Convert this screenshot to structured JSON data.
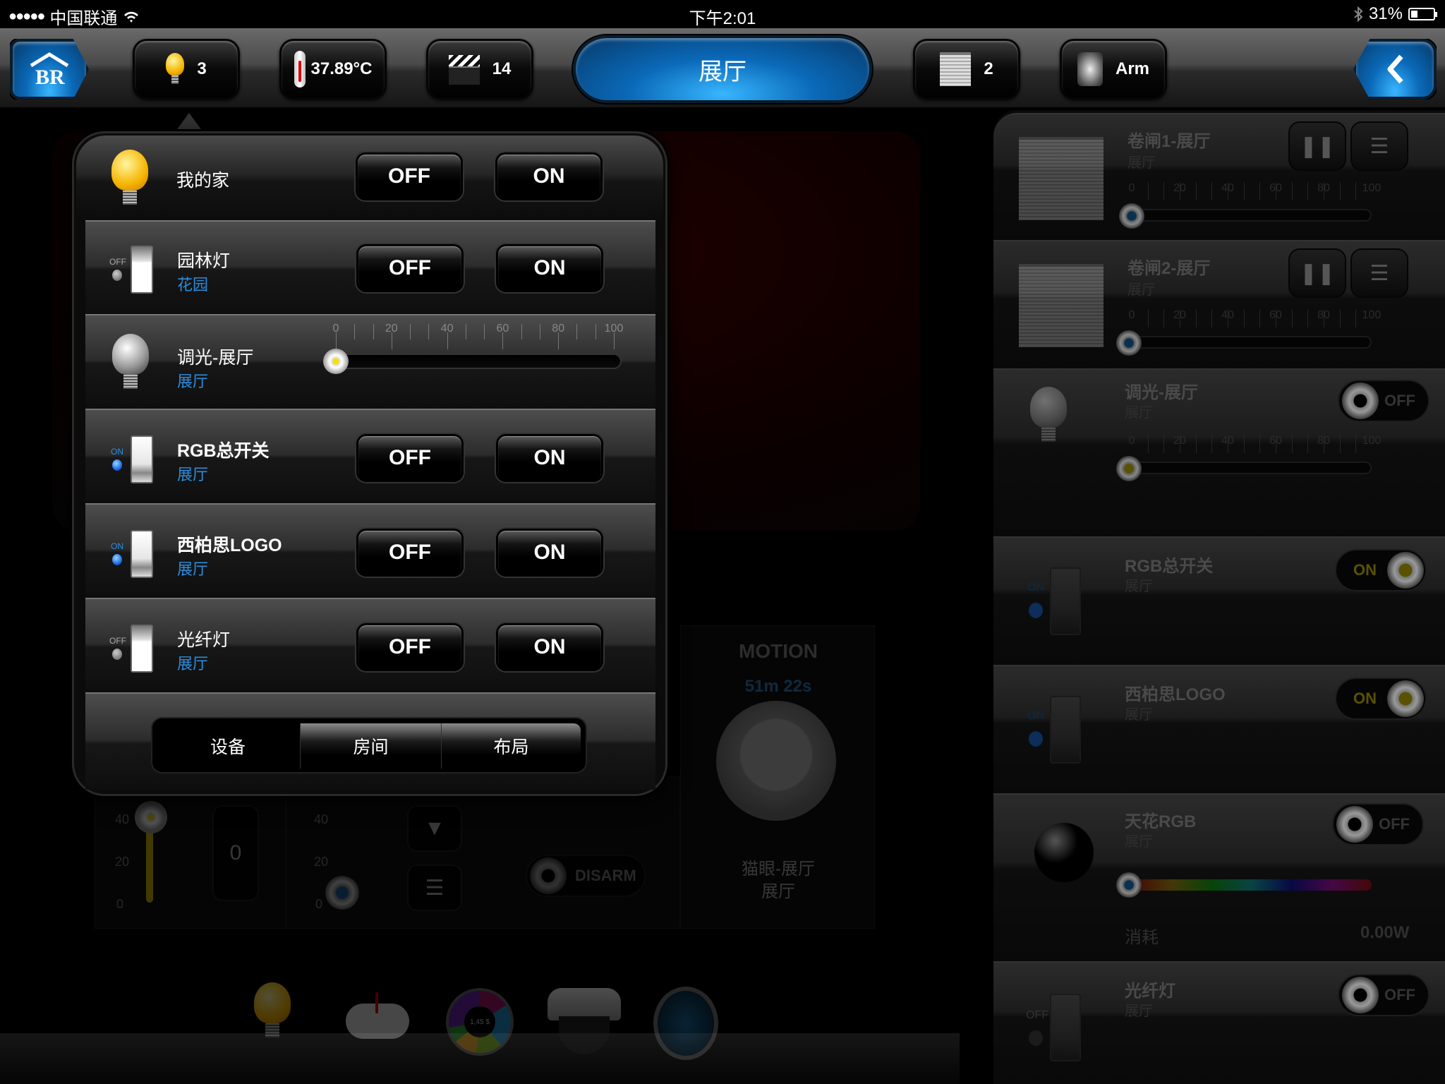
{
  "status_bar": {
    "signal": "●●●●●",
    "carrier": "中国联通",
    "wifi_icon": "wifi-icon",
    "time": "下午2:01",
    "bluetooth_icon": "bluetooth-icon",
    "battery": "31%",
    "battery_level": 0.31
  },
  "topbar": {
    "home_logo_icon": "br-house-logo-icon",
    "lights": {
      "icon": "light-bulb-icon",
      "count": "3"
    },
    "temperature": {
      "icon": "thermometer-icon",
      "value": "37.89°C"
    },
    "scenes": {
      "icon": "clapperboard-icon",
      "count": "14"
    },
    "room_title": "展厅",
    "shutters": {
      "icon": "shutter-icon",
      "count": "2"
    },
    "security": {
      "icon": "security-icon",
      "label": "Arm"
    },
    "back_icon": "chevron-left-icon"
  },
  "popup": {
    "header": {
      "name": "我的家",
      "off_label": "OFF",
      "on_label": "ON",
      "icon": "light-bulb-icon"
    },
    "rows": [
      {
        "type": "switch",
        "name": "园林灯",
        "location": "花园",
        "state_label": "OFF",
        "state": "off",
        "off_label": "OFF",
        "on_label": "ON"
      },
      {
        "type": "dimmer",
        "name": "调光-展厅",
        "location": "展厅",
        "value": 0,
        "scale": [
          "0",
          "20",
          "40",
          "60",
          "80",
          "100"
        ]
      },
      {
        "type": "switch",
        "name": "RGB总开关",
        "location": "展厅",
        "state_label": "ON",
        "state": "on",
        "off_label": "OFF",
        "on_label": "ON"
      },
      {
        "type": "switch",
        "name": "西柏思LOGO",
        "location": "展厅",
        "state_label": "ON",
        "state": "on",
        "off_label": "OFF",
        "on_label": "ON"
      },
      {
        "type": "switch",
        "name": "光纤灯",
        "location": "展厅",
        "state_label": "OFF",
        "state": "off",
        "off_label": "OFF",
        "on_label": "ON"
      }
    ],
    "segments": [
      {
        "label": "设备",
        "selected": true
      },
      {
        "label": "房间",
        "selected": false
      },
      {
        "label": "布局",
        "selected": false
      }
    ]
  },
  "background": {
    "sliders": {
      "scale_top": "40",
      "scale_mid": "20",
      "scale_bottom": "0",
      "counter_value": "0"
    },
    "security": {
      "toggle_label": "DISARM"
    },
    "motion": {
      "title": "MOTION",
      "timer": "51m 22s",
      "device": "猫眼-展厅",
      "location": "展厅"
    },
    "dock_icons": [
      "light-bulb-icon",
      "weather-thermometer-icon",
      "energy-chart-icon",
      "camera-dome-icon",
      "user-portrait-icon"
    ],
    "energy_chart_center": "1,45 $",
    "energy_chart_slices": [
      "16%",
      "22%",
      "14%",
      "12%",
      "8%",
      "28%"
    ]
  },
  "right_panel": {
    "shutters": [
      {
        "name": "卷闸1-展厅",
        "location": "展厅",
        "position": 0,
        "scale": [
          "0",
          "20",
          "40",
          "60",
          "80",
          "100"
        ]
      },
      {
        "name": "卷闸2-展厅",
        "location": "展厅",
        "position": 0,
        "scale": [
          "0",
          "20",
          "40",
          "60",
          "80",
          "100"
        ]
      }
    ],
    "dimmer": {
      "name": "调光-展厅",
      "location": "展厅",
      "toggle": "OFF",
      "value": 0,
      "scale": [
        "0",
        "20",
        "40",
        "60",
        "80",
        "100"
      ]
    },
    "rgb_master": {
      "name": "RGB总开关",
      "location": "展厅",
      "toggle": "ON",
      "led_label": "ON"
    },
    "logo": {
      "name": "西柏思LOGO",
      "location": "展厅",
      "toggle": "ON",
      "led_label": "ON"
    },
    "ceiling_rgb": {
      "name": "天花RGB",
      "location": "展厅",
      "toggle": "OFF",
      "consumption_label": "消耗",
      "consumption_value": "0.00W",
      "hue": 0
    },
    "fiber": {
      "name": "光纤灯",
      "location": "展厅",
      "toggle": "OFF",
      "led_label": "OFF"
    }
  }
}
